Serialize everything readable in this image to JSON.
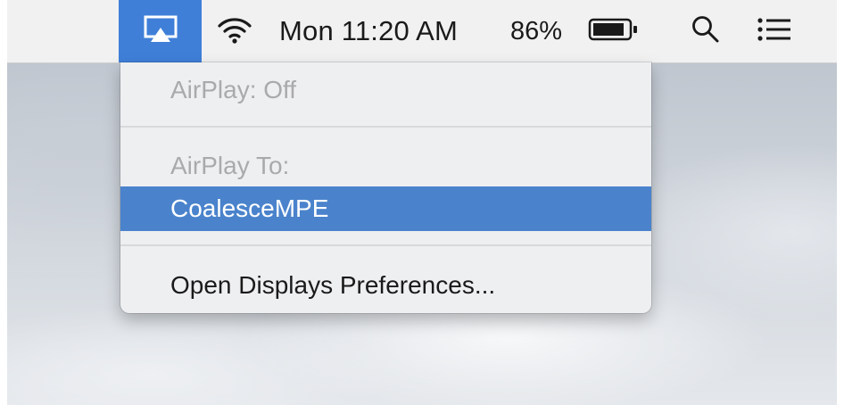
{
  "menubar": {
    "airplay_icon": "airplay-icon",
    "wifi_icon": "wifi-icon",
    "clock": "Mon 11:20 AM",
    "battery_percent": "86%",
    "battery_icon": "battery-icon",
    "search_icon": "search-icon",
    "notifications_icon": "list-icon",
    "accent_color": "#3f7fd8"
  },
  "airplay_menu": {
    "status": "AirPlay: Off",
    "section_header": "AirPlay To:",
    "devices": [
      "CoalesceMPE"
    ],
    "selected_device": "CoalesceMPE",
    "preferences_item": "Open Displays Preferences...",
    "highlight_color": "#4a83cc"
  }
}
